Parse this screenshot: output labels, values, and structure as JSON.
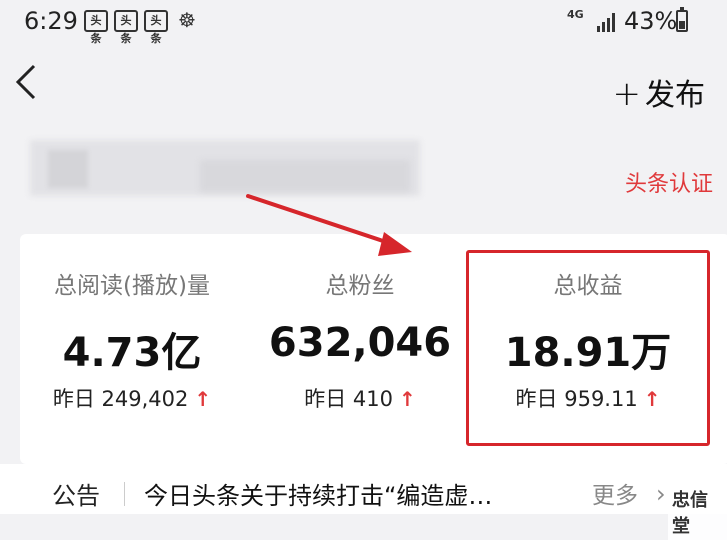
{
  "status": {
    "time": "6:29",
    "notifications": [
      "头条",
      "头条",
      "头条"
    ],
    "network": "4G",
    "battery": "43%"
  },
  "header": {
    "publish_plus": "+",
    "publish_label": "发布"
  },
  "profile": {
    "certification": "头条认证"
  },
  "stats": [
    {
      "label": "总阅读(播放)量",
      "value": "4.73亿",
      "yesterday_prefix": "昨日",
      "yesterday_value": "249,402",
      "trend": "↑"
    },
    {
      "label": "总粉丝",
      "value": "632,046",
      "yesterday_prefix": "昨日",
      "yesterday_value": "410",
      "trend": "↑"
    },
    {
      "label": "总收益",
      "value": "18.91万",
      "yesterday_prefix": "昨日",
      "yesterday_value": "959.11",
      "trend": "↑"
    }
  ],
  "notice": {
    "label": "公告",
    "text": "今日头条关于持续打击“编造虚…",
    "more": "更多",
    "chevron": "›"
  },
  "watermark": "忠信堂",
  "colors": {
    "accent_red": "#e0393b",
    "highlight_red": "#d6262b"
  }
}
